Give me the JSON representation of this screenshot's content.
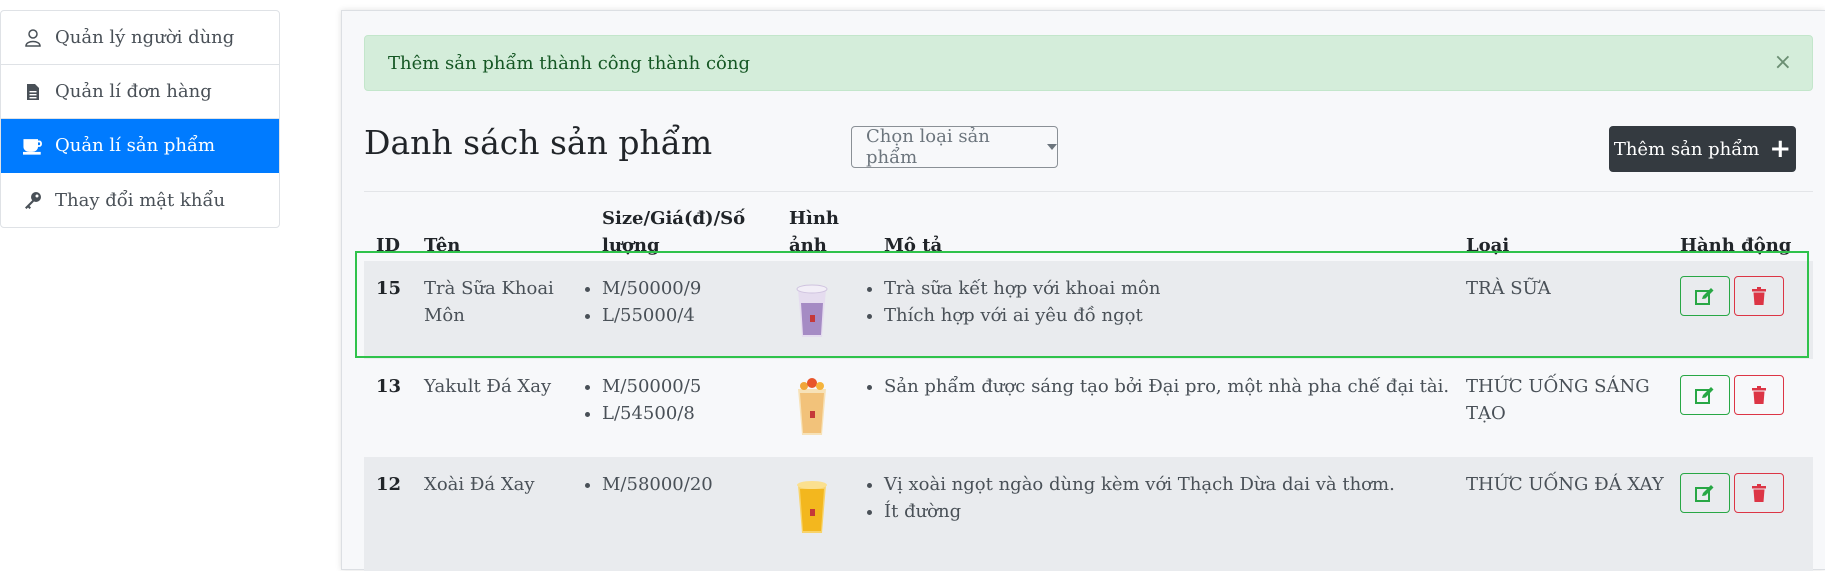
{
  "sidebar": {
    "items": [
      {
        "label": "Quản lý người dùng",
        "icon": "user-icon"
      },
      {
        "label": "Quản lí đơn hàng",
        "icon": "document-icon"
      },
      {
        "label": "Quản lí sản phẩm",
        "icon": "coffee-cup-icon",
        "active": true
      },
      {
        "label": "Thay đổi mật khẩu",
        "icon": "key-icon"
      }
    ]
  },
  "alert": {
    "message": "Thêm sản phẩm thành công thành công",
    "close": "×"
  },
  "main": {
    "title": "Danh sách sản phẩm",
    "category_select": "Chọn loại sản phẩm",
    "add_button": "Thêm sản phẩm"
  },
  "table": {
    "headers": {
      "id": "ID",
      "name": "Tên",
      "size_line1": "Size/Giá(đ)/Số",
      "size_line2": "lượng",
      "image_line1": "Hình",
      "image_line2": "ảnh",
      "description": "Mô tả",
      "category": "Loại",
      "actions": "Hành động"
    },
    "rows": [
      {
        "id": "15",
        "name_line1": "Trà Sữa Khoai",
        "name_line2": "Môn",
        "sizes": [
          "M/50000/9",
          "L/55000/4"
        ],
        "descriptions": [
          "Trà sữa kết hợp với khoai môn",
          "Thích hợp với ai yêu đồ ngọt"
        ],
        "category_line1": "TRÀ SỮA",
        "category_line2": "",
        "drink_color": "#a58bc4"
      },
      {
        "id": "13",
        "name_line1": "Yakult Đá Xay",
        "name_line2": "",
        "sizes": [
          "M/50000/5",
          "L/54500/8"
        ],
        "descriptions": [
          "Sản phẩm được sáng tạo bởi Đại pro, một nhà pha chế đại tài."
        ],
        "category_line1": "THỨC UỐNG SÁNG",
        "category_line2": "TẠO",
        "drink_color": "#f2c27a"
      },
      {
        "id": "12",
        "name_line1": "Xoài Đá Xay",
        "name_line2": "",
        "sizes": [
          "M/58000/20"
        ],
        "descriptions": [
          "Vị xoài ngọt ngào dùng kèm với Thạch Dừa dai và thơm.",
          "Ít đường"
        ],
        "category_line1": "THỨC UỐNG ĐÁ XAY",
        "category_line2": "",
        "drink_color": "#f3b71e"
      }
    ]
  },
  "colors": {
    "active": "#007bff",
    "success_bg": "#d4edda",
    "edit": "#28a745",
    "delete": "#dc3545",
    "dark_button": "#343a40",
    "highlight": "#2fc24b"
  }
}
